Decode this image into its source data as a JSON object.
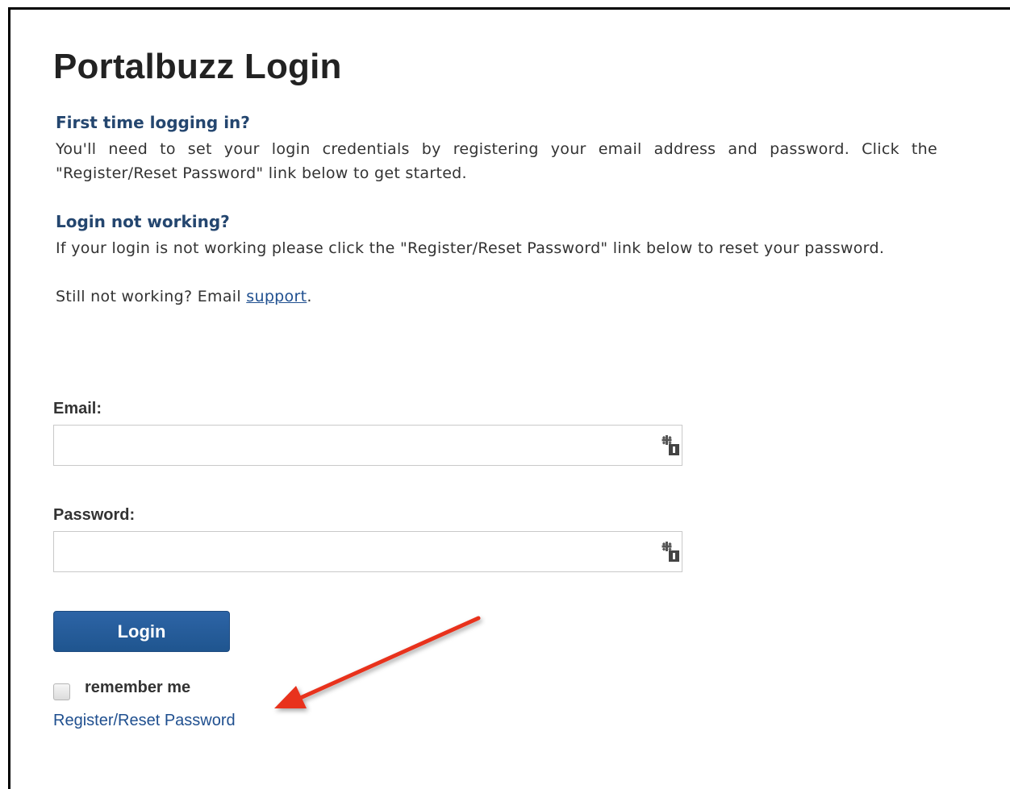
{
  "page": {
    "title": "Portalbuzz Login"
  },
  "intro": {
    "first_time_heading": "First time logging in?",
    "first_time_text": "You'll need to set your login credentials by registering your email address and password. Click the \"Register/Reset Password\" link below to get started.",
    "not_working_heading": "Login not working?",
    "not_working_text": "If your login is not working please click the \"Register/Reset Password\" link below to reset your password.",
    "still_not_working_prefix": "Still not working? Email ",
    "support_link": "support",
    "still_not_working_suffix": "."
  },
  "form": {
    "email_label": "Email:",
    "email_value": "",
    "password_label": "Password:",
    "password_value": "",
    "login_button": "Login",
    "remember_me_label": "remember me",
    "remember_me_checked": false,
    "register_link": "Register/Reset Password"
  },
  "icons": {
    "field_icon": "password-manager-key-icon",
    "annotation": "red-arrow"
  },
  "colors": {
    "heading_blue": "#24466f",
    "link_blue": "#1f4f8f",
    "button_blue": "#1f558f",
    "arrow_red": "#e8311f"
  }
}
